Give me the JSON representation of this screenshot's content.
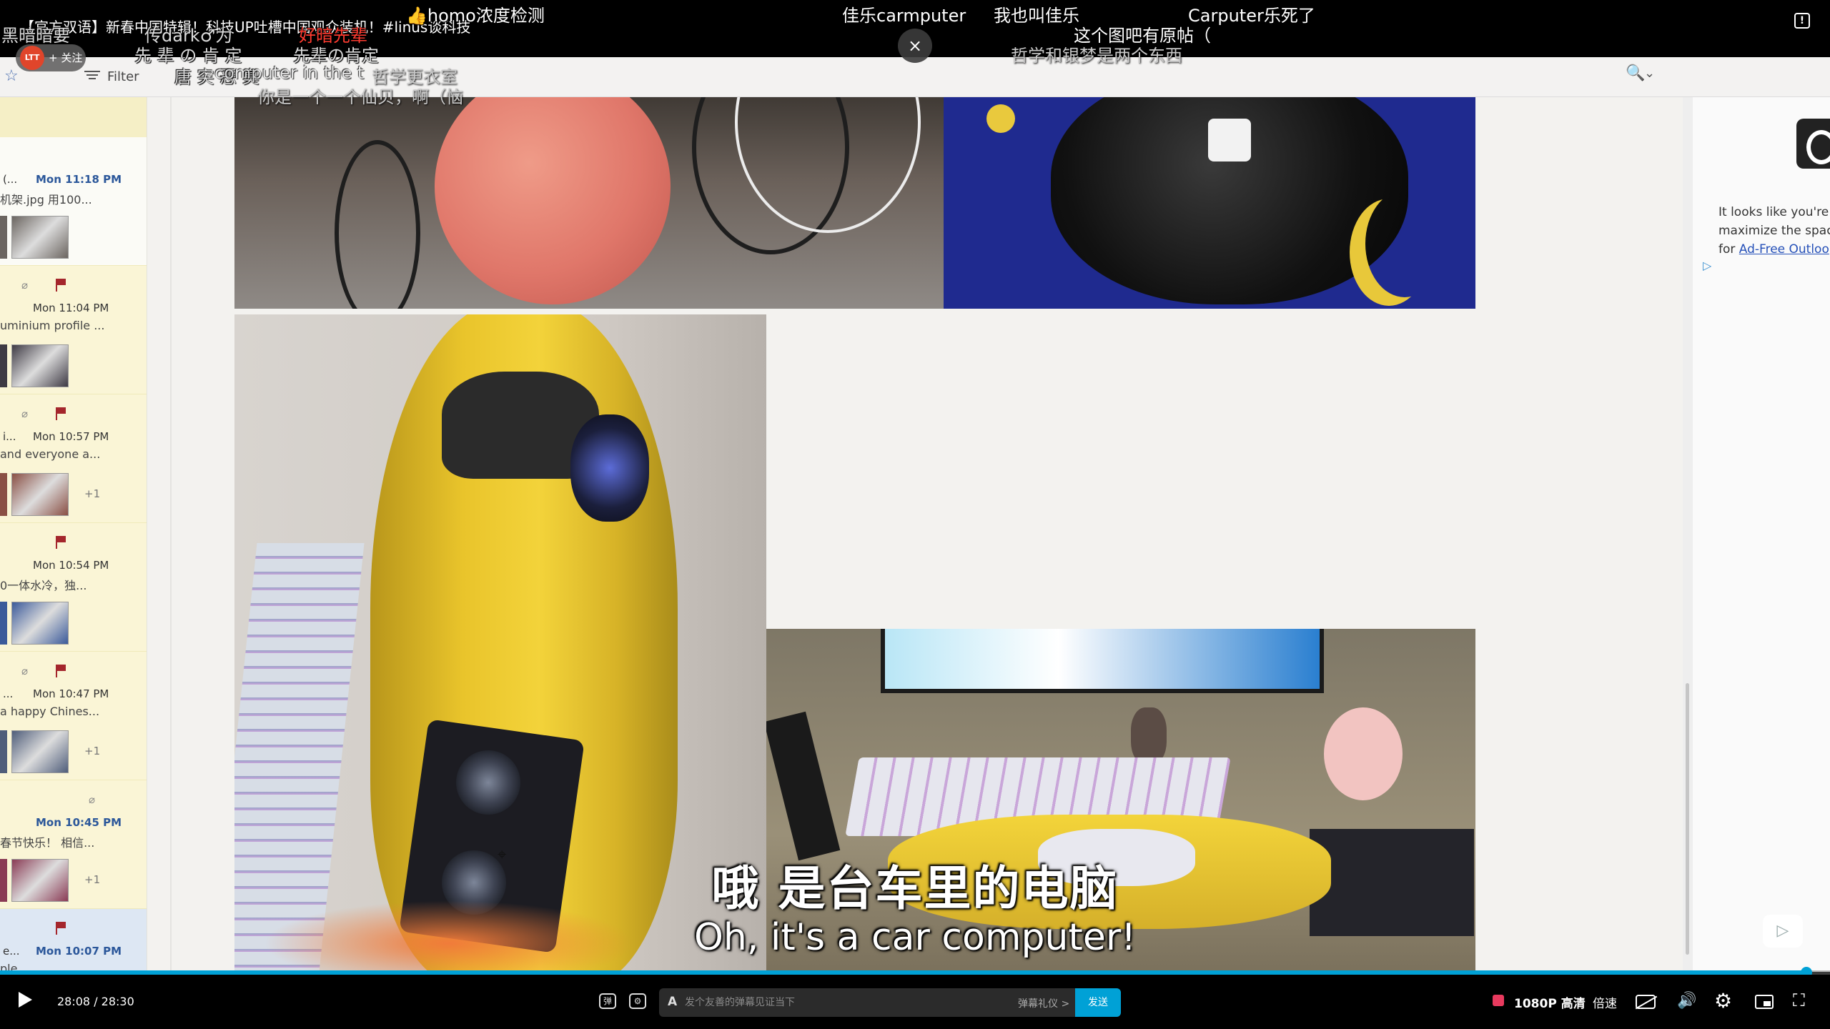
{
  "player": {
    "title": "【官方双语】新春中国特辑！科技UP吐槽中国观众装机！#linus谈科技",
    "uploader_avatar_text": "LTT",
    "follow_label": "+ 关注",
    "report_icon": "alert-icon",
    "close_overlay_icon": "×",
    "time_current": "28:08",
    "time_total": "28:30",
    "time_display": "28:08 / 28:30",
    "progress": 0.987,
    "danmaku_placeholder": "发个友善的弹幕见证当下",
    "danmaku_etiquette": "弹幕礼仪 >",
    "send_label": "发送",
    "quality_label": "1080P 高清",
    "speed_label": "倍速",
    "accent_color": "#00a1d6"
  },
  "subtitles": {
    "cn": "哦  是台车里的电脑",
    "en": "Oh, it's a car computer!"
  },
  "danmaku": [
    {
      "text": "👍homo浓度检测",
      "style": "white"
    },
    {
      "text": "佳乐carmputer",
      "style": "white"
    },
    {
      "text": "我也叫佳乐",
      "style": "white"
    },
    {
      "text": "Carputer乐死了",
      "style": "white"
    },
    {
      "text": "这个图吧有原帖（",
      "style": "white"
    },
    {
      "text": "哲学和银梦是两个东西",
      "style": "shade"
    },
    {
      "text": "黑暗暗要",
      "style": "dark"
    },
    {
      "text": "传dark♂为",
      "style": "dark"
    },
    {
      "text": "好暗先辈",
      "style": "red"
    },
    {
      "text": "先 辈 の 肯 定",
      "style": "dark"
    },
    {
      "text": "先辈の肯定",
      "style": "dark"
    },
    {
      "text": "唐  突  恶  臭",
      "style": "dark"
    },
    {
      "text": "哲学更衣室",
      "style": "shade"
    },
    {
      "text": "computer in the t",
      "style": "faint"
    },
    {
      "text": "你是一个一个仙贝，啊（恼",
      "style": "shade"
    }
  ],
  "outlook": {
    "filter_label": "Filter",
    "mail_items": [
      {
        "time": "Mon 11:18 PM",
        "preview": "机架.jpg 用100...",
        "dots": "(...",
        "unread": true,
        "plus": "",
        "clip": false,
        "flag": false
      },
      {
        "time": "Mon 11:04 PM",
        "preview": "uminium profile ...",
        "dots": "",
        "unread": false,
        "plus": "",
        "clip": true,
        "flag": true
      },
      {
        "time": "Mon 10:57 PM",
        "preview": "and everyone a...",
        "dots": "i...",
        "unread": false,
        "plus": "+1",
        "clip": true,
        "flag": true
      },
      {
        "time": "Mon 10:54 PM",
        "preview": "0一体水冷，独...",
        "dots": "",
        "unread": false,
        "plus": "",
        "clip": false,
        "flag": true
      },
      {
        "time": "Mon 10:47 PM",
        "preview": "a happy Chines...",
        "dots": "...",
        "unread": false,
        "plus": "+1",
        "clip": true,
        "flag": true
      },
      {
        "time": "Mon 10:45 PM",
        "preview": "春节快乐！ 相信...",
        "dots": "",
        "unread": true,
        "plus": "+1",
        "clip": true,
        "flag": false
      },
      {
        "time": "Mon 10:07 PM",
        "preview": "ple",
        "dots": "e...",
        "unread": true,
        "plus": "",
        "clip": false,
        "flag": true
      }
    ],
    "ad_text_line1": "It looks like you're u",
    "ad_text_line2": "maximize the space",
    "ad_text_line3_prefix": "for ",
    "ad_link": "Ad-Free Outloo"
  }
}
